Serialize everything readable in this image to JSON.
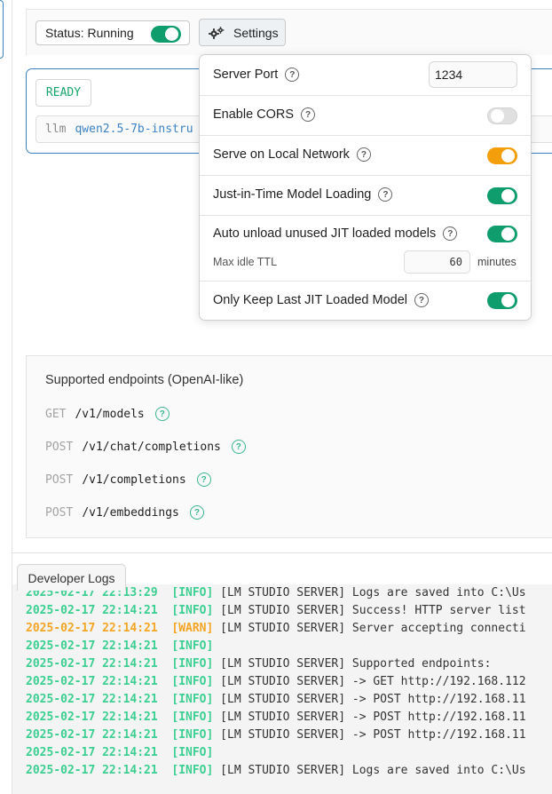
{
  "status": {
    "label": "Status: Running",
    "running": true
  },
  "settings_button": {
    "label": "Settings",
    "icon": "gears-icon"
  },
  "model_card": {
    "badge": "READY",
    "command_prefix": "llm",
    "model_name": "qwen2.5-7b-instru"
  },
  "settings_popover": {
    "server_port": {
      "label": "Server Port",
      "value": "1234"
    },
    "enable_cors": {
      "label": "Enable CORS",
      "enabled": false
    },
    "serve_local_network": {
      "label": "Serve on Local Network",
      "enabled": true
    },
    "jit_loading": {
      "label": "Just-in-Time Model Loading",
      "enabled": true
    },
    "auto_unload": {
      "label": "Auto unload unused JIT loaded models",
      "enabled": true
    },
    "max_idle_ttl": {
      "label": "Max idle TTL",
      "value": "60",
      "unit": "minutes"
    },
    "keep_last_jit": {
      "label": "Only Keep Last JIT Loaded Model",
      "enabled": true
    }
  },
  "endpoints": {
    "title": "Supported endpoints (OpenAI-like)",
    "items": [
      {
        "method": "GET",
        "path": "/v1/models"
      },
      {
        "method": "POST",
        "path": "/v1/chat/completions"
      },
      {
        "method": "POST",
        "path": "/v1/completions"
      },
      {
        "method": "POST",
        "path": "/v1/embeddings"
      }
    ]
  },
  "developer_logs": {
    "tab_label": "Developer Logs",
    "lines": [
      {
        "ts": "2025-02-17 22:13:29",
        "level": "[INFO]",
        "msg": "[LM STUDIO SERVER] Logs are saved into C:\\Us"
      },
      {
        "ts": "2025-02-17 22:14:21",
        "level": "[INFO]",
        "msg": "[LM STUDIO SERVER] Success! HTTP server list"
      },
      {
        "ts": "2025-02-17 22:14:21",
        "level": "[WARN]",
        "msg": "[LM STUDIO SERVER] Server accepting connecti"
      },
      {
        "ts": "2025-02-17 22:14:21",
        "level": "[INFO]",
        "msg": ""
      },
      {
        "ts": "2025-02-17 22:14:21",
        "level": "[INFO]",
        "msg": "[LM STUDIO SERVER] Supported endpoints:"
      },
      {
        "ts": "2025-02-17 22:14:21",
        "level": "[INFO]",
        "msg": "[LM STUDIO SERVER] -> GET http://192.168.112"
      },
      {
        "ts": "2025-02-17 22:14:21",
        "level": "[INFO]",
        "msg": "[LM STUDIO SERVER] -> POST http://192.168.11"
      },
      {
        "ts": "2025-02-17 22:14:21",
        "level": "[INFO]",
        "msg": "[LM STUDIO SERVER] -> POST http://192.168.11"
      },
      {
        "ts": "2025-02-17 22:14:21",
        "level": "[INFO]",
        "msg": "[LM STUDIO SERVER] -> POST http://192.168.11"
      },
      {
        "ts": "2025-02-17 22:14:21",
        "level": "[INFO]",
        "msg": ""
      },
      {
        "ts": "2025-02-17 22:14:21",
        "level": "[INFO]",
        "msg": "[LM STUDIO SERVER] Logs are saved into C:\\Us"
      }
    ]
  },
  "colors": {
    "toggle_on": "#0f9d6e",
    "toggle_network": "#f59e0b",
    "log_info": "#3ccf91",
    "log_warn": "#f5a524",
    "accent_blue": "#3b82c4"
  }
}
